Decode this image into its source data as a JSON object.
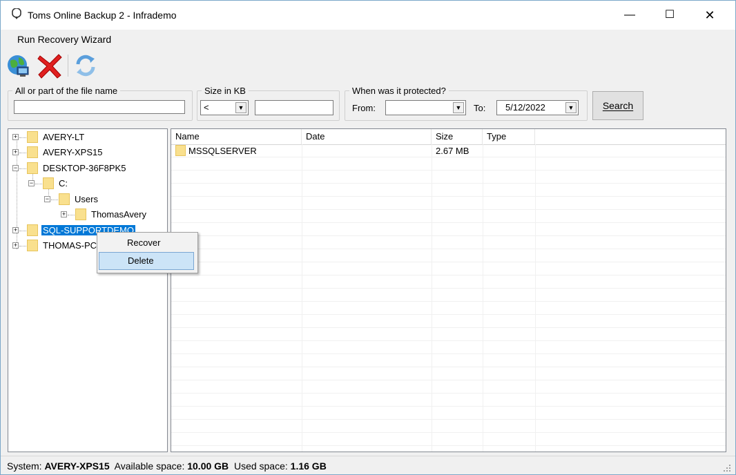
{
  "window": {
    "title": "Toms Online Backup 2 - Infrademo"
  },
  "menu": {
    "run_recovery": "Run Recovery Wizard"
  },
  "filters": {
    "file_name_label": "All or part of the file name",
    "file_name_value": "",
    "size_label": "Size in KB",
    "size_operator": "<",
    "size_value": "",
    "protected_label": "When was it protected?",
    "from_label": "From:",
    "from_value": "",
    "to_label": "To:",
    "to_value": "5/12/2022",
    "search_label": "Search"
  },
  "tree": {
    "nodes": [
      {
        "label": "AVERY-LT",
        "expander": "+"
      },
      {
        "label": "AVERY-XPS15",
        "expander": "+"
      },
      {
        "label": "DESKTOP-36F8PK5",
        "expander": "−"
      },
      {
        "label": "C:",
        "expander": "−"
      },
      {
        "label": "Users",
        "expander": "−"
      },
      {
        "label": "ThomasAvery",
        "expander": "+"
      },
      {
        "label": "SQL-SUPPORTDEMO",
        "expander": "+"
      },
      {
        "label": "THOMAS-PC",
        "expander": "+"
      }
    ]
  },
  "list": {
    "columns": [
      "Name",
      "Date",
      "Size",
      "Type"
    ],
    "rows": [
      {
        "name": "MSSQLSERVER",
        "date": "",
        "size": "2.67 MB",
        "type": ""
      }
    ]
  },
  "context_menu": {
    "items": [
      "Recover",
      "Delete"
    ],
    "highlighted": "Delete"
  },
  "status": {
    "system_label": "System:",
    "system_value": "AVERY-XPS15",
    "available_label": "Available space:",
    "available_value": "10.00 GB",
    "used_label": "Used space:",
    "used_value": "1.16 GB"
  }
}
